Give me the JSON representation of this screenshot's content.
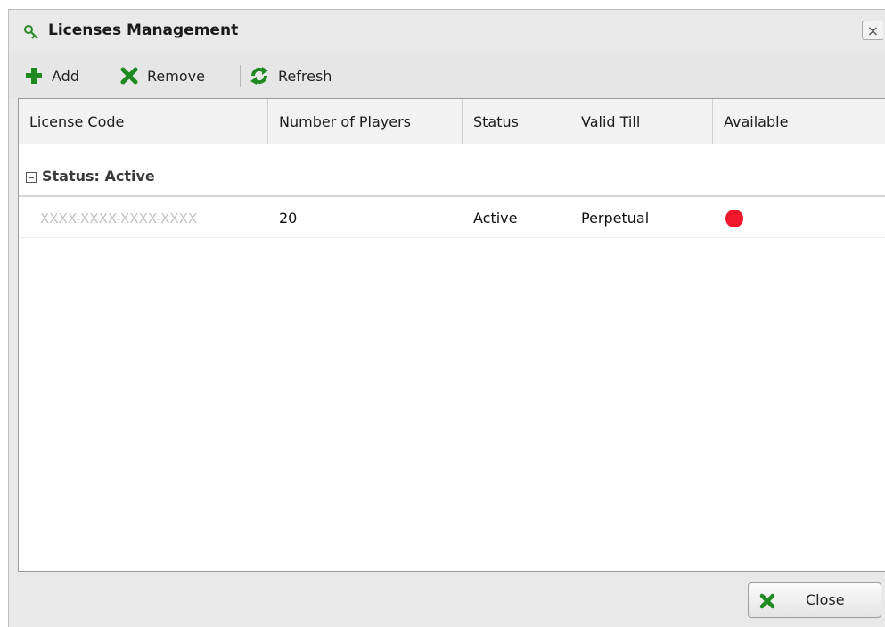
{
  "window": {
    "title": "Licenses Management",
    "close_glyph": "×"
  },
  "toolbar": {
    "add_label": "Add",
    "remove_label": "Remove",
    "refresh_label": "Refresh"
  },
  "grid": {
    "columns": [
      "License Code",
      "Number of Players",
      "Status",
      "Valid Till",
      "Available"
    ],
    "group_label": "Status: Active",
    "rows": [
      {
        "license_code": "XXXX-XXXX-XXXX-XXXX",
        "players": "20",
        "status": "Active",
        "valid_till": "Perpetual",
        "available_color": "#f2162a"
      }
    ]
  },
  "footer": {
    "close_label": "Close"
  },
  "colors": {
    "icon_green": "#1f8a1f",
    "available_dot": "#f2162a"
  },
  "icons": {
    "title": "key-icon",
    "add": "plus-icon",
    "remove": "x-icon",
    "refresh": "refresh-icon",
    "close": "x-icon"
  }
}
